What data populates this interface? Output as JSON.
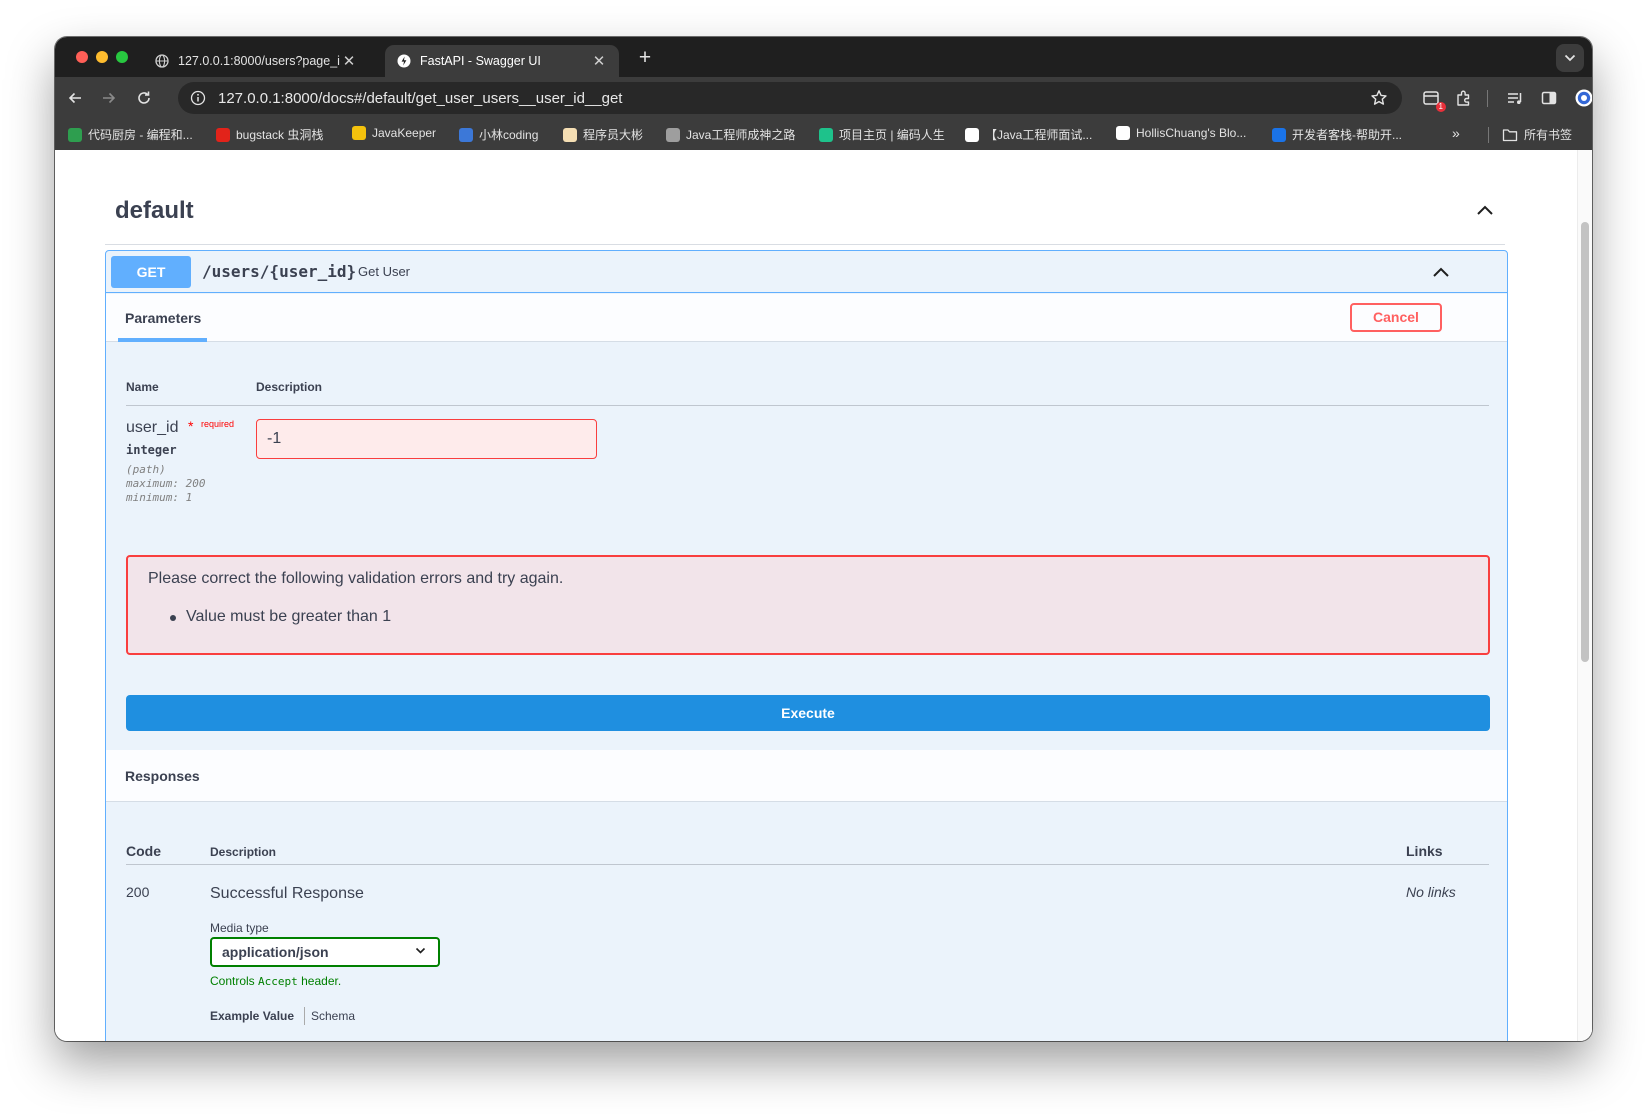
{
  "browser": {
    "tabs": [
      {
        "title": "127.0.0.1:8000/users?page_i",
        "active": false
      },
      {
        "title": "FastAPI - Swagger UI",
        "active": true
      }
    ],
    "url": "127.0.0.1:8000/docs#/default/get_user_users__user_id__get",
    "extension_badge": "1",
    "bookmarks": [
      {
        "label": "代码厨房 - 编程和...",
        "icon_color": "#2e9e4f"
      },
      {
        "label": "bugstack 虫洞栈",
        "icon_color": "#e2231a"
      },
      {
        "label": "JavaKeeper",
        "icon_color": "#f4c20d"
      },
      {
        "label": "小林coding",
        "icon_color": "#3c78d8"
      },
      {
        "label": "程序员大彬",
        "icon_color": "#f5deb3"
      },
      {
        "label": "Java工程师成神之路",
        "icon_color": "#9e9e9e"
      },
      {
        "label": "项目主页 | 编码人生",
        "icon_color": "#1ec28b"
      },
      {
        "label": "【Java工程师面试...",
        "icon_color": "#ffffff"
      },
      {
        "label": "HollisChuang's Blo...",
        "icon_color": "#ffffff"
      },
      {
        "label": "开发者客栈-帮助开...",
        "icon_color": "#1a73e8"
      }
    ],
    "all_bookmarks_label": "所有书签"
  },
  "swagger": {
    "section_title": "default",
    "operation": {
      "method": "GET",
      "path": "/users/{user_id}",
      "summary": "Get User"
    },
    "parameters_tab": "Parameters",
    "cancel_label": "Cancel",
    "table_headers": {
      "name": "Name",
      "description": "Description"
    },
    "param": {
      "name": "user_id",
      "required_star": "*",
      "required_label": "required",
      "type": "integer",
      "in": "(path)",
      "maximum": "maximum: 200",
      "minimum": "minimum: 1",
      "value": "-1"
    },
    "validation": {
      "title": "Please correct the following validation errors and try again.",
      "errors": [
        "Value must be greater than 1"
      ]
    },
    "execute_label": "Execute",
    "responses": {
      "title": "Responses",
      "headers": {
        "code": "Code",
        "description": "Description",
        "links": "Links"
      },
      "rows": [
        {
          "code": "200",
          "description": "Successful Response",
          "links": "No links",
          "media_type_label": "Media type",
          "media_type_value": "application/json",
          "controls_prefix": "Controls",
          "controls_mono": "Accept",
          "controls_suffix": "header.",
          "example_value_tab": "Example Value",
          "schema_tab": "Schema"
        }
      ]
    }
  },
  "colors": {
    "get_accent": "#61affe",
    "error_red": "#f93e3e",
    "execute_blue": "#1f8fe0",
    "success_green": "#008000"
  }
}
